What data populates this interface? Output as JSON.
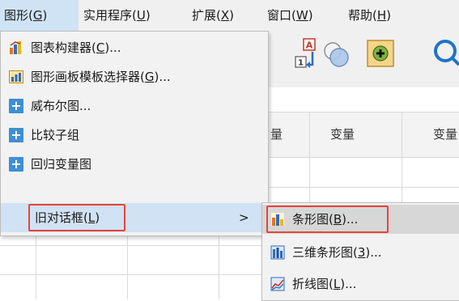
{
  "menubar": {
    "items": [
      {
        "label": "图形(",
        "key": "G",
        "close": ")"
      },
      {
        "label": "实用程序(",
        "key": "U",
        "close": ")"
      },
      {
        "label": "扩展(",
        "key": "X",
        "close": ")"
      },
      {
        "label": "窗口(",
        "key": "W",
        "close": ")"
      },
      {
        "label": "帮助(",
        "key": "H",
        "close": ")"
      }
    ]
  },
  "grid": {
    "headers": [
      "量",
      "变量",
      "变量"
    ]
  },
  "menu": {
    "items": [
      {
        "label": "图表构建器(",
        "key": "C",
        "tail": ")..."
      },
      {
        "label": "图形画板模板选择器(",
        "key": "G",
        "tail": ")..."
      },
      {
        "label": "威布尔图..."
      },
      {
        "label": "比较子组"
      },
      {
        "label": "回归变量图"
      },
      {
        "label": "旧对话框(",
        "key": "L",
        "tail": ")",
        "arrow": ">"
      }
    ]
  },
  "submenu": {
    "items": [
      {
        "label": "条形图(",
        "key": "B",
        "tail": ")..."
      },
      {
        "label": "三维条形图(",
        "key": "3",
        "tail": ")..."
      },
      {
        "label": "折线图(",
        "key": "L",
        "tail": ")..."
      }
    ]
  },
  "colors": {
    "menu_highlight": "#d0e2f3",
    "submenu_highlight": "#d7d7d7",
    "red_box": "#e8433a",
    "plus_icon": "#3d8fd6"
  }
}
